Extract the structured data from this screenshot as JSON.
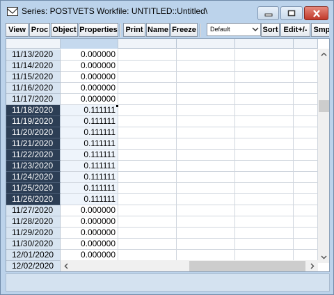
{
  "window": {
    "title": "Series: POSTVETS   Workfile: UNTITLED::Untitled\\",
    "accent": "#bcd3eb",
    "selected_row_color": "#2c3e55"
  },
  "toolbar": {
    "view": "View",
    "proc": "Proc",
    "object": "Object",
    "properties": "Properties",
    "print": "Print",
    "name": "Name",
    "freeze": "Freeze",
    "default_select": "Default",
    "sort": "Sort",
    "edit": "Edit+/-",
    "smpl": "Smpl"
  },
  "grid": {
    "rows": [
      {
        "date": "11/13/2020",
        "value": "0.000000",
        "selected": false
      },
      {
        "date": "11/14/2020",
        "value": "0.000000",
        "selected": false
      },
      {
        "date": "11/15/2020",
        "value": "0.000000",
        "selected": false
      },
      {
        "date": "11/16/2020",
        "value": "0.000000",
        "selected": false
      },
      {
        "date": "11/17/2020",
        "value": "0.000000",
        "selected": false
      },
      {
        "date": "11/18/2020",
        "value": "0.111111",
        "selected": true
      },
      {
        "date": "11/19/2020",
        "value": "0.111111",
        "selected": true
      },
      {
        "date": "11/20/2020",
        "value": "0.111111",
        "selected": true
      },
      {
        "date": "11/21/2020",
        "value": "0.111111",
        "selected": true
      },
      {
        "date": "11/22/2020",
        "value": "0.111111",
        "selected": true
      },
      {
        "date": "11/23/2020",
        "value": "0.111111",
        "selected": true
      },
      {
        "date": "11/24/2020",
        "value": "0.111111",
        "selected": true
      },
      {
        "date": "11/25/2020",
        "value": "0.111111",
        "selected": true
      },
      {
        "date": "11/26/2020",
        "value": "0.111111",
        "selected": true
      },
      {
        "date": "11/27/2020",
        "value": "0.000000",
        "selected": false
      },
      {
        "date": "11/28/2020",
        "value": "0.000000",
        "selected": false
      },
      {
        "date": "11/29/2020",
        "value": "0.000000",
        "selected": false
      },
      {
        "date": "11/30/2020",
        "value": "0.000000",
        "selected": false
      },
      {
        "date": "12/01/2020",
        "value": "0.000000",
        "selected": false
      },
      {
        "date": "12/02/2020",
        "value": "",
        "selected": false
      }
    ]
  }
}
